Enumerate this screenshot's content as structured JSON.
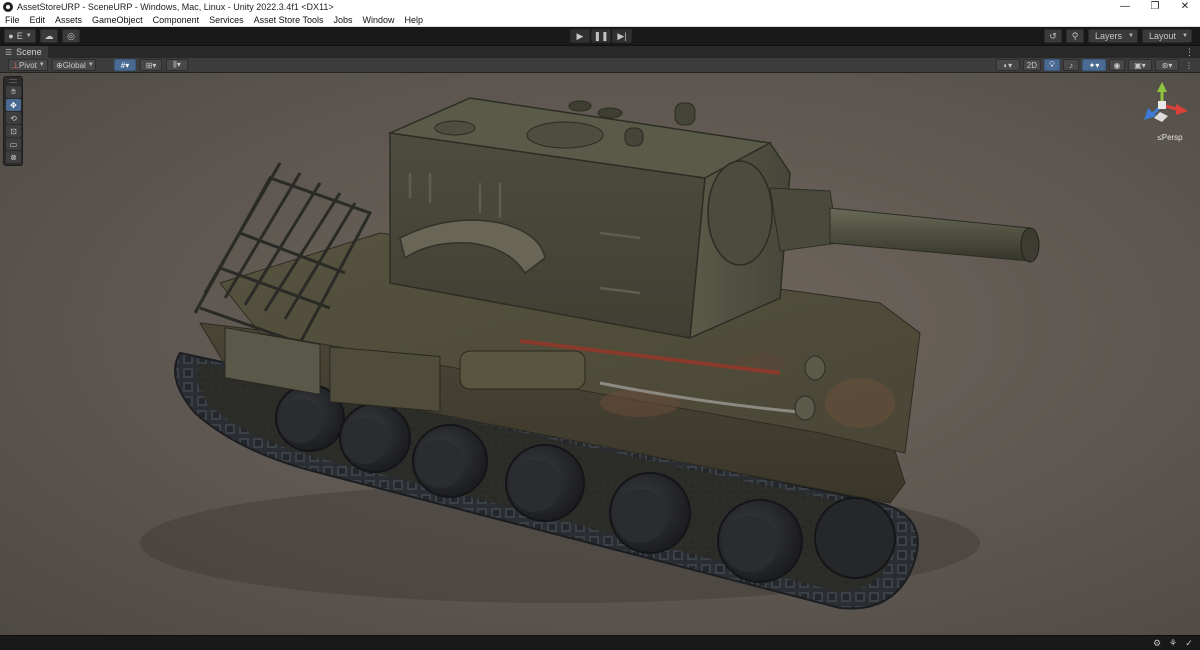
{
  "window": {
    "title": "AssetStoreURP - SceneURP - Windows, Mac, Linux - Unity 2022.3.4f1 <DX11>",
    "controls": {
      "minimize": "—",
      "restore": "❐",
      "close": "✕"
    }
  },
  "menubar": {
    "items": [
      "File",
      "Edit",
      "Assets",
      "GameObject",
      "Component",
      "Services",
      "Asset Store Tools",
      "Jobs",
      "Window",
      "Help"
    ]
  },
  "toolbar": {
    "account_label": "E",
    "play_controls": [
      "play-icon",
      "pause-icon",
      "step-icon"
    ],
    "layers_label": "Layers",
    "layout_label": "Layout"
  },
  "scene_tab": {
    "label": "Scene"
  },
  "scene_toolbar": {
    "pivot_label": "Pivot",
    "global_label": "Global",
    "mode_2d_label": "2D"
  },
  "tools": [
    "hand-tool",
    "move-tool",
    "rotate-tool",
    "scale-tool",
    "rect-tool",
    "transform-tool"
  ],
  "gizmo": {
    "axes": [
      "x",
      "y",
      "z"
    ],
    "projection_label": "Persp",
    "colors": {
      "x": "#d9413a",
      "y": "#8fc43e",
      "z": "#3c7ad6"
    }
  },
  "colors": {
    "accent": "#4a6a92",
    "viewport_bg": "#5e5751",
    "tank_body": "#4a4a3c",
    "tank_track": "#2c2f33"
  }
}
